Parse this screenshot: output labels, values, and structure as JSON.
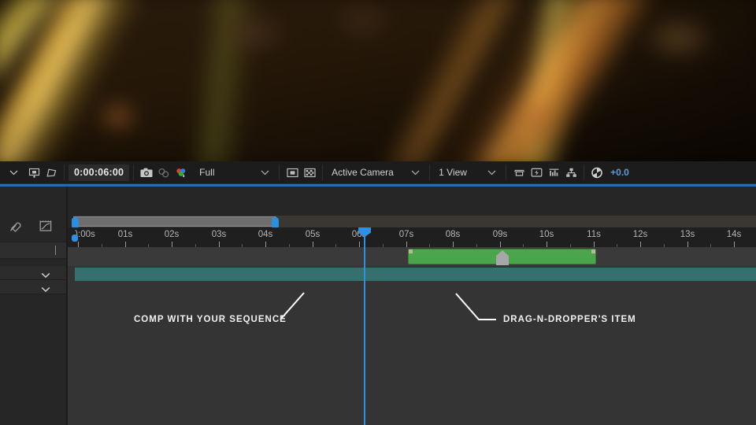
{
  "viewer": {
    "name": "composition-preview",
    "description": "blurred bokeh footage of backlit golden grass stalks on dark brown background"
  },
  "viewer_toolbar": {
    "items": [
      {
        "name": "panel-menu-chevron",
        "icon": "chevron-down-icon",
        "label": ""
      },
      {
        "name": "toggle-transparency-grid",
        "icon": "transparency-grid-icon",
        "label": ""
      },
      {
        "name": "toggle-mask-visibility",
        "icon": "mask-shape-icon",
        "label": ""
      }
    ],
    "timecode": "0:00:06:00",
    "snapshot_icon": "camera-icon",
    "show_snapshot_icon": "show-snapshot-icon",
    "channels_icon": "rgb-channels-icon",
    "resolution": "Full",
    "region_of_interest_icon": "region-of-interest-icon",
    "transparency_grid_icon": "checkerboard-icon",
    "camera": "Active Camera",
    "views": "1 View",
    "pixel_aspect_icon": "pixel-aspect-icon",
    "fast_previews_icon": "fast-previews-icon",
    "timeline_graph_icon": "timeline-graph-icon",
    "renderer_icon": "renderer-icon",
    "exposure_icon": "exposure-aperture-icon",
    "exposure_value": "+0.0"
  },
  "timeline": {
    "tools": [
      {
        "name": "eraser-tool",
        "icon": "eraser-icon"
      },
      {
        "name": "graph-editor-toggle",
        "icon": "graph-editor-icon"
      }
    ],
    "search_placeholder": "",
    "layer_rows": [
      {
        "name": "layer-row-1",
        "label": "",
        "expand_icon": "chevron-down-icon"
      },
      {
        "name": "layer-row-2",
        "label": "",
        "expand_icon": "chevron-down-icon"
      }
    ],
    "ruler": {
      "start_label": "):00s",
      "ticks": [
        "01s",
        "02s",
        "03s",
        "04s",
        "05s",
        "06s",
        "07s",
        "08s",
        "09s",
        "10s",
        "11s",
        "12s",
        "13s",
        "14s"
      ]
    },
    "playhead_time": "0:00:06:00",
    "clips": [
      {
        "name": "dragndropper-clip",
        "color": "#4ba54b",
        "marker_icon": "home-marker-icon"
      },
      {
        "name": "sequence-comp-clip",
        "color": "#36706e"
      }
    ],
    "navigator": {
      "name": "time-navigator",
      "handle_color": "#2b8fe0"
    }
  },
  "annotations": [
    {
      "name": "annotation-comp-sequence",
      "text": "COMP WITH YOUR SEQUENCE"
    },
    {
      "name": "annotation-dragndropper-item",
      "text": "DRAG-N-DROPPER'S ITEM"
    }
  ],
  "colors": {
    "accent_blue": "#2f8fe3",
    "clip_green": "#4ba54b",
    "clip_teal": "#36706e",
    "panel_bg": "#262626"
  }
}
